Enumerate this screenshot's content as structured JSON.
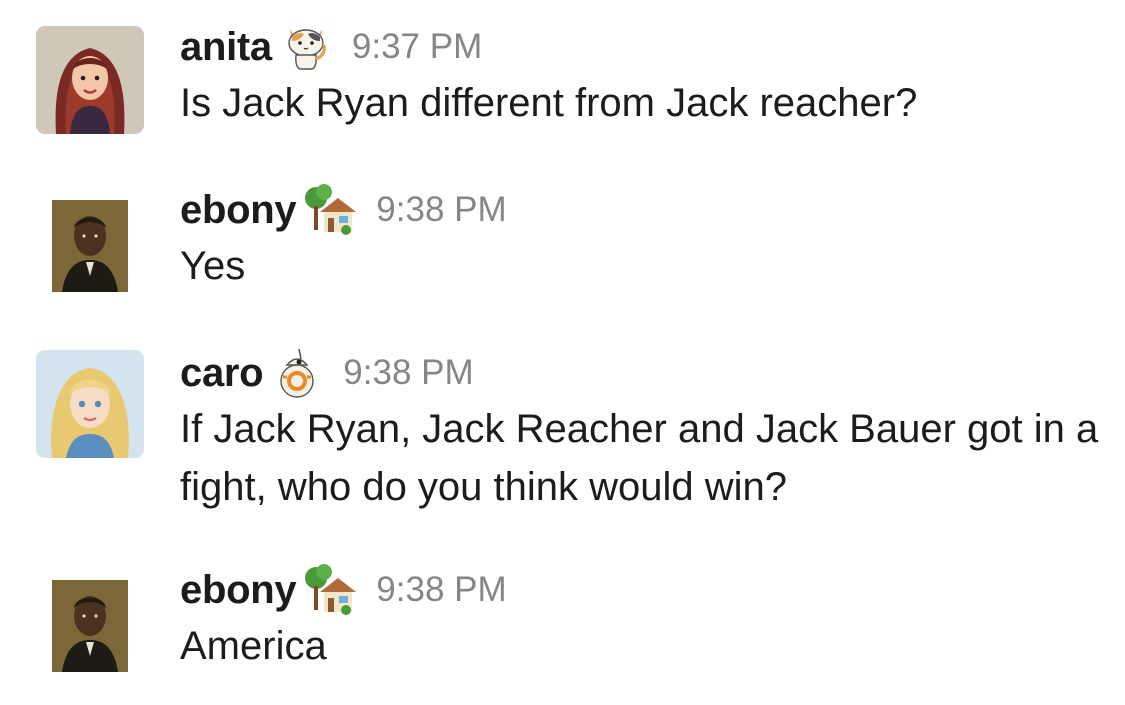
{
  "messages": [
    {
      "author": "anita",
      "status_icon": "cat-emoji-icon",
      "time": "9:37 PM",
      "text": "Is Jack Ryan different from Jack reacher?"
    },
    {
      "author": "ebony",
      "status_icon": "house-with-garden-icon",
      "time": "9:38 PM",
      "text": "Yes"
    },
    {
      "author": "caro",
      "status_icon": "bb8-droid-icon",
      "time": "9:38 PM",
      "text": "If Jack Ryan, Jack Reacher and Jack Bauer got in a fight, who do you think would win?"
    },
    {
      "author": "ebony",
      "status_icon": "house-with-garden-icon",
      "time": "9:38 PM",
      "text": "America"
    }
  ],
  "colors": {
    "name": "#1d1c1d",
    "timestamp": "#868686",
    "text": "#1d1c1d",
    "background": "#ffffff"
  }
}
